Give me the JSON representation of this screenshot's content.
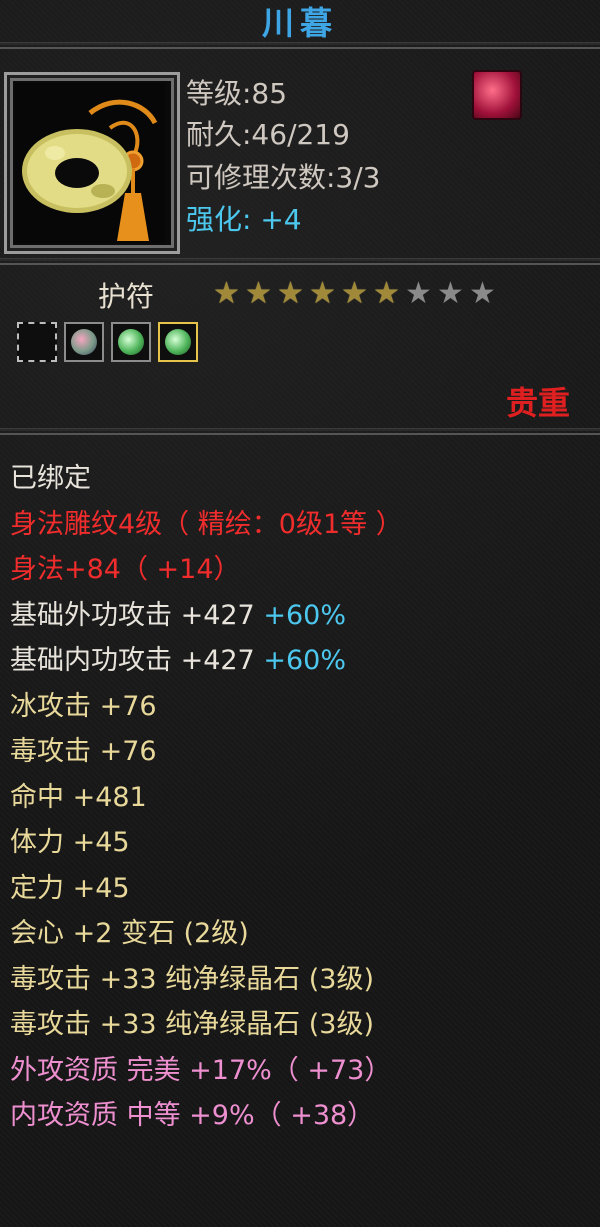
{
  "title": "川暮",
  "item": {
    "icon": "jade-ring-amulet-icon",
    "attributes": [
      {
        "text": "等级:85"
      },
      {
        "text": "耐久:46/219"
      },
      {
        "text": "可修理次数:3/3"
      },
      {
        "text": "强化: +4"
      }
    ],
    "skill_icon": "flame-skill-icon"
  },
  "type_label": "护符",
  "stars": {
    "filled": 6,
    "total": 9
  },
  "sockets": [
    {
      "state": "empty"
    },
    {
      "state": "mixed-gem"
    },
    {
      "state": "green-gem"
    },
    {
      "state": "green-gem-selected"
    }
  ],
  "rarity": "贵重",
  "stats": {
    "bound": "已绑定",
    "carving": "身法雕纹4级（ 精绘：0级1等 ）",
    "agility": "身法+84（ +14）",
    "ext_attack": {
      "label": "基础外功攻击  +427",
      "bonus": "+60%"
    },
    "int_attack": {
      "label": "基础内功攻击  +427",
      "bonus": "+60%"
    },
    "ice_attack": "冰攻击  +76",
    "poison_attack": "毒攻击  +76",
    "accuracy": "命中  +481",
    "stamina": "体力  +45",
    "focus": "定力  +45",
    "crit_gem": "会心  +2  变石 (2级)",
    "poison_gem_1": "毒攻击  +33  纯净绿晶石 (3级)",
    "poison_gem_2": "毒攻击  +33  纯净绿晶石 (3级)",
    "ext_quality": "外攻资质   完美  +17%（ +73）",
    "int_quality": "内攻资质   中等  +9%（ +38）"
  },
  "colors": {
    "title": "#3fa6e6",
    "rarity": "#e02020",
    "enhance": "#4cc8ee",
    "quality": "#ee8fd0"
  }
}
